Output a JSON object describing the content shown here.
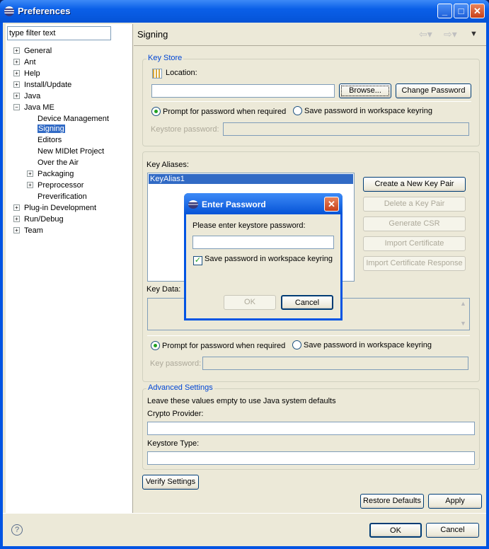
{
  "window": {
    "title": "Preferences"
  },
  "filter": {
    "value": "type filter text"
  },
  "tree": [
    {
      "label": "General",
      "expander": "+"
    },
    {
      "label": "Ant",
      "expander": "+"
    },
    {
      "label": "Help",
      "expander": "+"
    },
    {
      "label": "Install/Update",
      "expander": "+"
    },
    {
      "label": "Java",
      "expander": "+"
    },
    {
      "label": "Java ME",
      "expander": "−"
    },
    {
      "label": "Device Management",
      "expander": ""
    },
    {
      "label": "Signing",
      "expander": "",
      "selected": true
    },
    {
      "label": "Editors",
      "expander": ""
    },
    {
      "label": "New MIDlet Project",
      "expander": ""
    },
    {
      "label": "Over the Air",
      "expander": ""
    },
    {
      "label": "Packaging",
      "expander": "+"
    },
    {
      "label": "Preprocessor",
      "expander": "+"
    },
    {
      "label": "Preverification",
      "expander": ""
    },
    {
      "label": "Plug-in Development",
      "expander": "+"
    },
    {
      "label": "Run/Debug",
      "expander": "+"
    },
    {
      "label": "Team",
      "expander": "+"
    }
  ],
  "page": {
    "title": "Signing"
  },
  "keystore": {
    "group": "Key Store",
    "location_label": "Location:",
    "location_value": "",
    "browse": "Browse...",
    "change_password": "Change Password",
    "radio_prompt": "Prompt for password when required",
    "radio_save": "Save password in workspace keyring",
    "password_label": "Keystore password:"
  },
  "aliases": {
    "label": "Key Aliases:",
    "items": [
      "KeyAlias1"
    ],
    "create": "Create a New Key Pair",
    "delete": "Delete a Key Pair",
    "csr": "Generate CSR",
    "import_cert": "Import Certificate",
    "import_resp": "Import Certificate Response",
    "key_data_label": "Key Data:",
    "radio_prompt": "Prompt for password when required",
    "radio_save": "Save password in workspace keyring",
    "key_password_label": "Key password:"
  },
  "advanced": {
    "group": "Advanced Settings",
    "hint": "Leave these values empty to use Java system defaults",
    "crypto_label": "Crypto Provider:",
    "crypto_value": "",
    "type_label": "Keystore Type:",
    "type_value": ""
  },
  "buttons": {
    "verify": "Verify Settings",
    "restore": "Restore Defaults",
    "apply": "Apply",
    "ok": "OK",
    "cancel": "Cancel"
  },
  "dialog": {
    "title": "Enter Password",
    "prompt": "Please enter keystore password:",
    "password_value": "",
    "save_checkbox": "Save password in workspace keyring",
    "ok": "OK",
    "cancel": "Cancel"
  }
}
